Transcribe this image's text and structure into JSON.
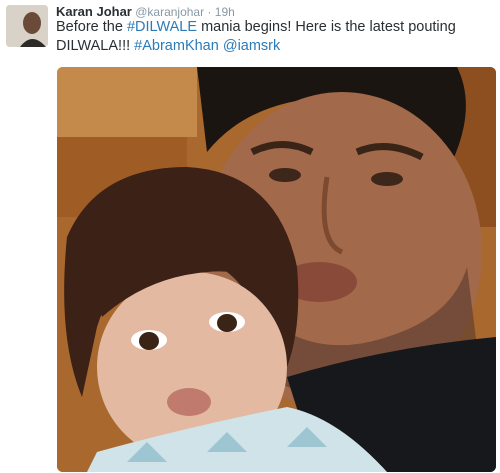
{
  "tweet": {
    "author_name": "Karan Johar",
    "author_handle": "@karanjohar",
    "separator": "·",
    "time": "19h",
    "text_parts": [
      {
        "text": "Before the ",
        "link": false
      },
      {
        "text": "#DILWALE",
        "link": true
      },
      {
        "text": " mania begins! Here is the latest pouting DILWALA!!! ",
        "link": false
      },
      {
        "text": "#AbramKhan",
        "link": true
      },
      {
        "text": " ",
        "link": false
      },
      {
        "text": "@iamsrk",
        "link": true
      }
    ]
  },
  "colors": {
    "link": "#2b7bb9",
    "text": "#292f33",
    "meta": "#8899a6"
  },
  "icons": {
    "avatar": "profile-photo",
    "photo": "selfie-man-and-child"
  }
}
